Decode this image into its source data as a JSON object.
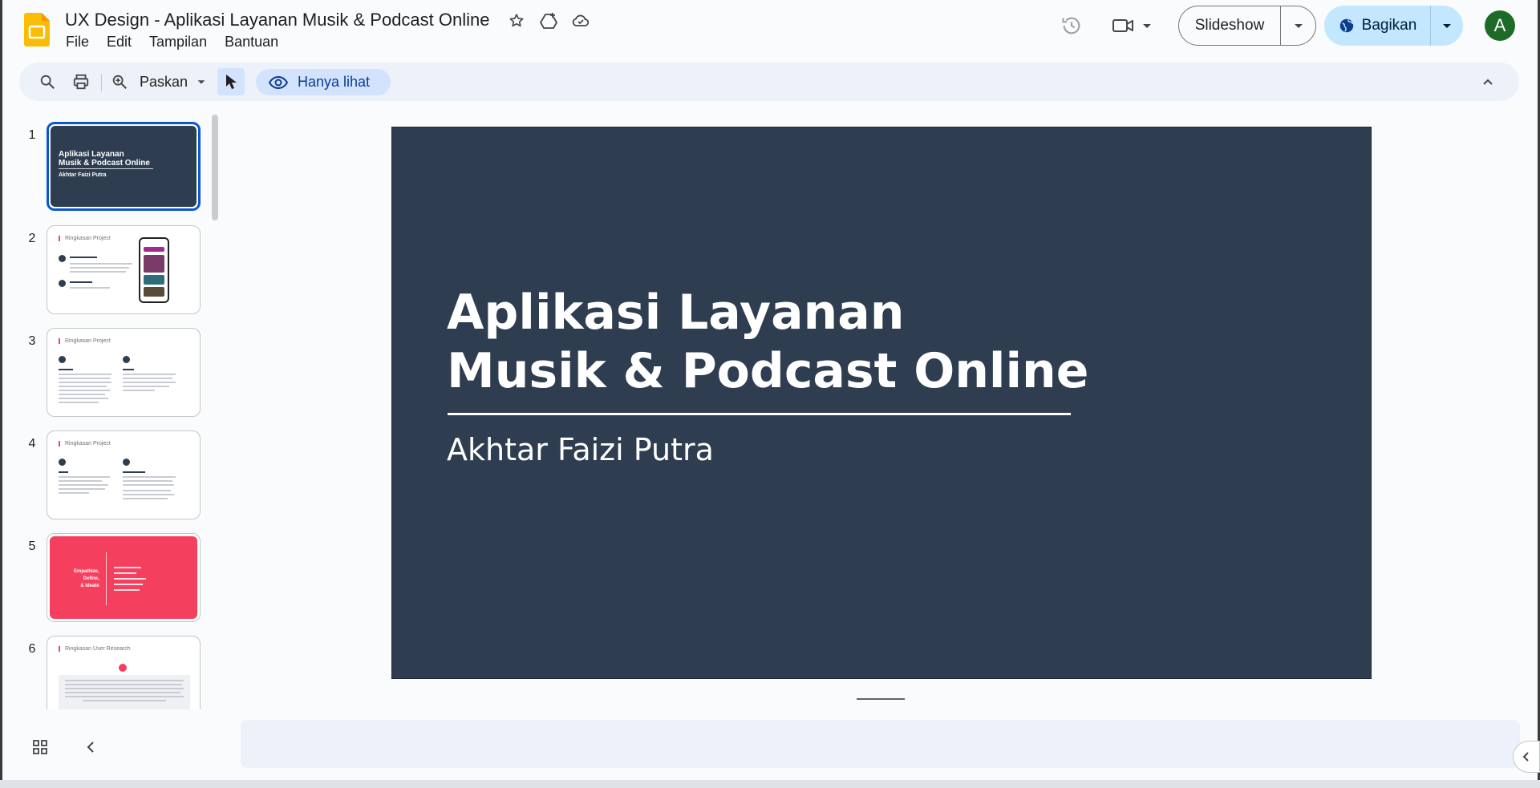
{
  "header": {
    "doc_title": "UX Design - Aplikasi Layanan Musik & Podcast Online",
    "menu": [
      "File",
      "Edit",
      "Tampilan",
      "Bantuan"
    ],
    "slideshow_label": "Slideshow",
    "share_label": "Bagikan",
    "avatar_initial": "A",
    "icons": [
      "star-icon",
      "add-to-drive-icon",
      "cloud-saved-icon",
      "history-icon",
      "video-camera-icon"
    ]
  },
  "toolbar": {
    "zoom_label": "Paskan",
    "view_only_label": "Hanya lihat"
  },
  "filmstrip": {
    "slides": [
      {
        "number": "1",
        "title_line1": "Aplikasi Layanan",
        "title_line2": "Musik & Podcast Online",
        "subtitle": "Akhtar Faizi Putra"
      },
      {
        "number": "2",
        "heading": "Ringkasan Project"
      },
      {
        "number": "3",
        "heading": "Ringkasan Project"
      },
      {
        "number": "4",
        "heading": "Ringkasan Project"
      },
      {
        "number": "5",
        "title_line1": "Empathize,",
        "title_line2": "Define,",
        "title_line3": "& Ideate"
      },
      {
        "number": "6",
        "heading": "Ringkasan User Research"
      }
    ]
  },
  "slide": {
    "title": "Aplikasi Layanan\nMusik & Podcast Online",
    "subtitle": "Akhtar Faizi Putra",
    "background": "#2e3d50"
  },
  "colors": {
    "accent": "#0b57d0",
    "share_bg": "#c2e7ff",
    "slide_dark": "#2e3d50",
    "slide_pink": "#f53f5f",
    "avatar_bg": "#1e6b28"
  }
}
